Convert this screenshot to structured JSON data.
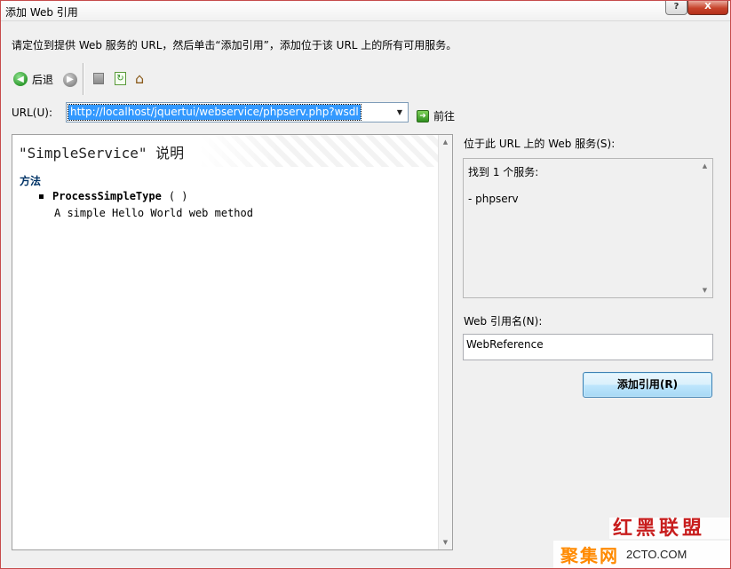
{
  "window": {
    "title": "添加 Web 引用",
    "help_label": "?",
    "close_label": "X"
  },
  "instruction": "请定位到提供 Web 服务的 URL，然后单击“添加引用”，添加位于该 URL 上的所有可用服务。",
  "toolbar": {
    "back_label": "后退",
    "go_label": "前往"
  },
  "url": {
    "label": "URL(U):",
    "value": "http://localhost/jquertui/webservice/phpserv.php?wsdl"
  },
  "browser": {
    "service_title": "\"SimpleService\" 说明",
    "methods_heading": "方法",
    "methods": [
      {
        "name": "ProcessSimpleType",
        "params": "( )",
        "description": "A simple Hello World web method"
      }
    ]
  },
  "services_panel": {
    "label": "位于此 URL 上的 Web 服务(S):",
    "found_text": "找到 1 个服务:",
    "items": [
      "- phpserv"
    ]
  },
  "reference_name": {
    "label": "Web 引用名(N):",
    "value": "WebReference"
  },
  "add_reference_label": "添加引用(R)",
  "watermark": {
    "top_text": "红黑联盟",
    "bottom_cn": "聚集网",
    "bottom_en": "2CTO.COM"
  },
  "colors": {
    "window_border": "#c64b4b",
    "url_selection": "#3399ff",
    "button_border": "#3c7fb1",
    "methods_heading": "#003366"
  },
  "icons": {
    "back": "green-circle-left-arrow",
    "forward": "gray-circle-right-arrow",
    "stop": "stop-page-icon",
    "refresh": "refresh-page-icon",
    "home": "home-icon",
    "go": "green-right-arrow"
  }
}
